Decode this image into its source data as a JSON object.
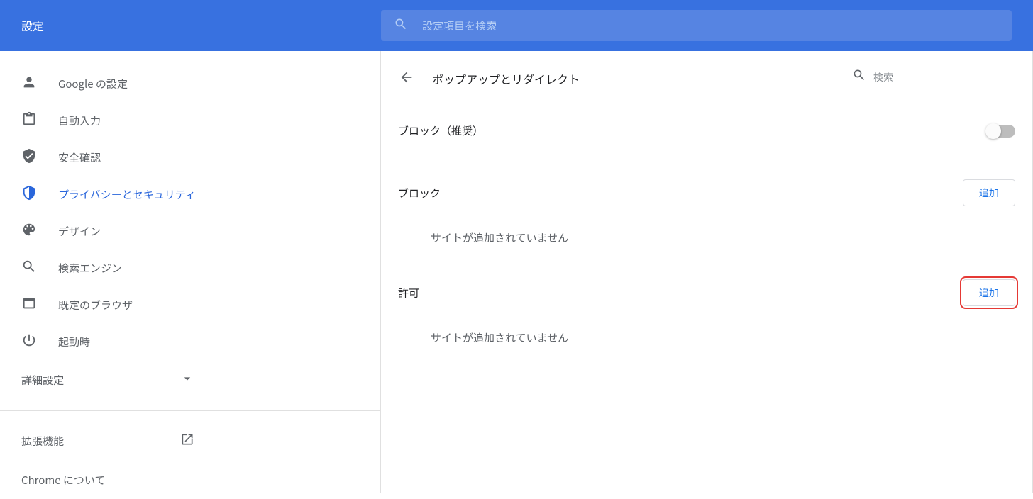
{
  "header": {
    "title": "設定",
    "search_placeholder": "設定項目を検索"
  },
  "sidebar": {
    "items": [
      {
        "icon": "person",
        "label": "Google の設定"
      },
      {
        "icon": "clipboard",
        "label": "自動入力"
      },
      {
        "icon": "shield-check",
        "label": "安全確認"
      },
      {
        "icon": "shield",
        "label": "プライバシーとセキュリティ",
        "active": true
      },
      {
        "icon": "palette",
        "label": "デザイン"
      },
      {
        "icon": "search",
        "label": "検索エンジン"
      },
      {
        "icon": "browser",
        "label": "既定のブラウザ"
      },
      {
        "icon": "power",
        "label": "起動時"
      }
    ],
    "advanced_label": "詳細設定",
    "footer": {
      "extensions_label": "拡張機能",
      "about_label": "Chrome について"
    }
  },
  "main": {
    "page_title": "ポップアップとリダイレクト",
    "mini_search_placeholder": "検索",
    "block_recommended_label": "ブロック（推奨）",
    "toggle_on": false,
    "sections": {
      "block": {
        "title": "ブロック",
        "add_button": "追加",
        "empty_text": "サイトが追加されていません"
      },
      "allow": {
        "title": "許可",
        "add_button": "追加",
        "empty_text": "サイトが追加されていません"
      }
    }
  }
}
